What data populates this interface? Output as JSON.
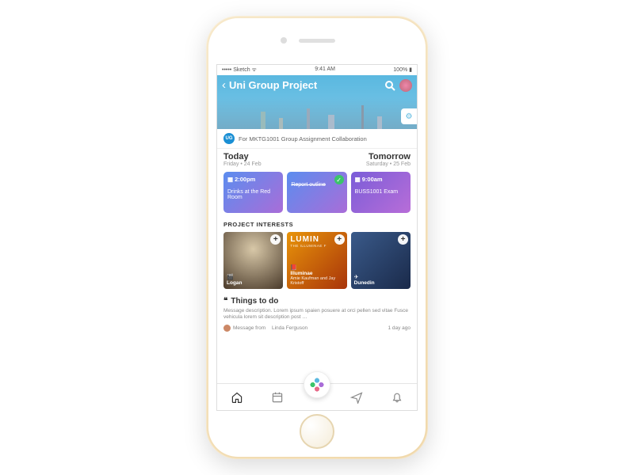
{
  "status": {
    "left": "••••• Sketch ᯤ",
    "time": "9:41 AM",
    "right": "100% ▮"
  },
  "header": {
    "title": "Uni Group Project"
  },
  "description": {
    "badge": "UG",
    "text": "For MKTG1001 Group Assignment Collaboration"
  },
  "schedule": {
    "today": {
      "label": "Today",
      "sub": "Friday • 24 Feb"
    },
    "tomorrow": {
      "label": "Tomorrow",
      "sub": "Saturday • 25 Feb"
    },
    "cards": [
      {
        "time": "2:00pm",
        "title": "Drinks at the Red Room",
        "done": false
      },
      {
        "time": "",
        "title": "Report outline",
        "done": true
      },
      {
        "time": "9:00am",
        "title": "BUSS1001 Exam",
        "done": false
      }
    ]
  },
  "interests": {
    "heading": "PROJECT INTERESTS",
    "items": [
      {
        "icon": "🎬",
        "title": "Logan",
        "sub": ""
      },
      {
        "head1": "LUMIN",
        "head2": "THE ILLUMINAE F",
        "icon": "📕",
        "title": "Illuminae",
        "sub": "Amie Kaufman and Jay Kristoff"
      },
      {
        "icon": "✈",
        "title": "Dunedin",
        "sub": ""
      }
    ]
  },
  "todo": {
    "heading": "Things to do",
    "body": "Message description. Lorem ipsum spaien posuere at orci pellen sed vitae Fusce vehicula lorem sit description post …",
    "from_prefix": "Message from",
    "from_name": "Linda Ferguson",
    "age": "1 day ago"
  }
}
